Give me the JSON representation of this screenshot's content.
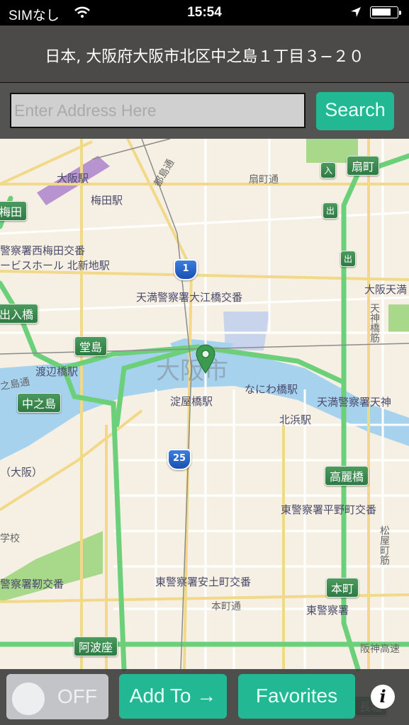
{
  "status_bar": {
    "carrier": "SIMなし",
    "time": "15:54",
    "wifi_icon": "wifi-icon",
    "location_icon": "location-arrow-icon",
    "battery_icon": "battery-icon"
  },
  "header": {
    "address": "日本, 大阪府大阪市北区中之島１丁目３−２０"
  },
  "search": {
    "placeholder": "Enter Address Here",
    "value": "",
    "button_label": "Search"
  },
  "map": {
    "city_label": "大阪市",
    "pin_icon": "map-pin-icon",
    "labels": [
      {
        "text": "大阪駅"
      },
      {
        "text": "梅田駅"
      },
      {
        "text": "都島通"
      },
      {
        "text": "扇町通"
      },
      {
        "text": "警察署西梅田交番"
      },
      {
        "text": "ービスホール 北新地駅"
      },
      {
        "text": "天満警察署大江橋交番"
      },
      {
        "text": "大阪天満"
      },
      {
        "text": "天神橋筋"
      },
      {
        "text": "渡辺橋駅"
      },
      {
        "text": "之島通"
      },
      {
        "text": "淀屋橋駅"
      },
      {
        "text": "なにわ橋駅"
      },
      {
        "text": "天満警察署天神"
      },
      {
        "text": "北浜駅"
      },
      {
        "text": "（大阪）"
      },
      {
        "text": "東警察署平野町交番"
      },
      {
        "text": "学校"
      },
      {
        "text": "松屋町筋"
      },
      {
        "text": "警察署靭交番"
      },
      {
        "text": "東警察署安土町交番"
      },
      {
        "text": "本町通"
      },
      {
        "text": "東警察署"
      },
      {
        "text": "阪神高速"
      }
    ],
    "shields": [
      {
        "text": "扇町"
      },
      {
        "text": "入"
      },
      {
        "text": "出"
      },
      {
        "text": "出"
      },
      {
        "text": "梅田"
      },
      {
        "text": "出入橋"
      },
      {
        "text": "堂島"
      },
      {
        "text": "中之島"
      },
      {
        "text": "高麗橋"
      },
      {
        "text": "本町"
      },
      {
        "text": "阿波座"
      },
      {
        "text": "長堀"
      }
    ],
    "routes": [
      {
        "number": "1"
      },
      {
        "number": "25"
      }
    ]
  },
  "bottom_bar": {
    "toggle_label": "OFF",
    "toggle_state": "off",
    "add_to_label": "Add To →",
    "favorites_label": "Favorites",
    "info_icon": "info-icon",
    "info_glyph": "i"
  },
  "colors": {
    "accent": "#22b894",
    "bar_bg": "#3c3c3c",
    "map_bg": "#f6f0e4",
    "highway": "#6ccf7a",
    "water": "#a6d2ee",
    "pin": "#3a9a4e"
  }
}
